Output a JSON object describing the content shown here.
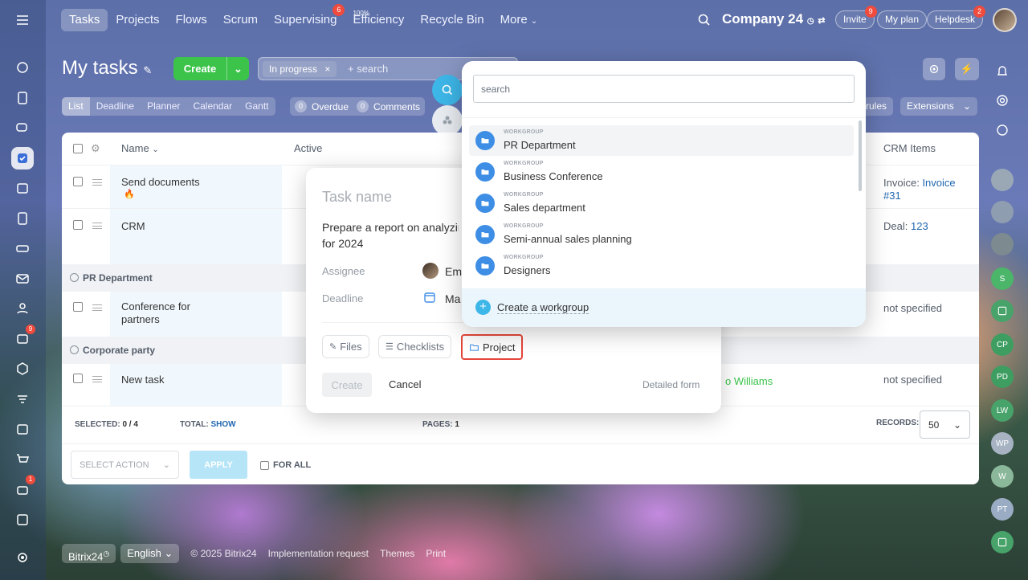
{
  "nav": {
    "items": [
      {
        "label": "Tasks",
        "active": true
      },
      {
        "label": "Projects"
      },
      {
        "label": "Flows"
      },
      {
        "label": "Scrum"
      },
      {
        "label": "Supervising",
        "badge": "6"
      },
      {
        "label": "Efficiency",
        "sup": "100%"
      },
      {
        "label": "Recycle Bin"
      },
      {
        "label": "More"
      }
    ],
    "company": "Company 24",
    "invite": "Invite",
    "invite_badge": "9",
    "my_plan": "My plan",
    "helpdesk": "Helpdesk",
    "helpdesk_badge": "2"
  },
  "left_badges": {
    "feed": "9",
    "shop": "1"
  },
  "header": {
    "title": "My tasks",
    "create": "Create",
    "filter_chip": "In progress",
    "filter_placeholder": "+ search"
  },
  "view_tabs": [
    "List",
    "Deadline",
    "Planner",
    "Calendar",
    "Gantt"
  ],
  "counters": [
    {
      "count": "0",
      "label": "Overdue"
    },
    {
      "count": "0",
      "label": "Comments"
    }
  ],
  "right_controls": {
    "rules": "rules",
    "extensions": "Extensions"
  },
  "table": {
    "col_name": "Name",
    "col_active": "Active",
    "col_crm": "CRM Items",
    "rows": [
      {
        "name": "Send documents",
        "crm_label": "Invoice:",
        "crm_link": "Invoice #31"
      },
      {
        "name": "CRM",
        "crm_label": "Deal:",
        "crm_link": "123"
      }
    ],
    "group1": "PR Department",
    "row3": {
      "name": "Conference for partners",
      "crm": "not specified"
    },
    "group2": "Corporate party",
    "row4": {
      "name": "New task",
      "responsible": "o Williams",
      "crm": "not specified"
    },
    "selected_label": "SELECTED:",
    "selected_value": "0 / 4",
    "total_label": "TOTAL:",
    "total_value": "SHOW",
    "pages_label": "PAGES:",
    "pages_value": "1",
    "records_label": "RECORDS:",
    "records_value": "50",
    "select_action": "SELECT ACTION",
    "apply": "APPLY",
    "for_all": "FOR ALL"
  },
  "quick_form": {
    "title_placeholder": "Task name",
    "description": "Prepare a report on analyzin",
    "description_line2": "for 2024",
    "assignee_label": "Assignee",
    "assignee_value": "Em",
    "deadline_label": "Deadline",
    "deadline_value": "Ma",
    "files": "Files",
    "checklists": "Checklists",
    "project": "Project",
    "create": "Create",
    "cancel": "Cancel",
    "detailed": "Detailed form"
  },
  "dropdown": {
    "search_placeholder": "search",
    "items": [
      {
        "kind": "WORKGROUP",
        "name": "PR Department"
      },
      {
        "kind": "WORKGROUP",
        "name": "Business Conference"
      },
      {
        "kind": "WORKGROUP",
        "name": "Sales department"
      },
      {
        "kind": "WORKGROUP",
        "name": "Semi-annual sales planning"
      },
      {
        "kind": "WORKGROUP",
        "name": "Designers"
      }
    ],
    "create_label": "Create a workgroup"
  },
  "right_bar": [
    "S",
    "CP",
    "PD",
    "LW",
    "WP",
    "W",
    "PT"
  ],
  "footer": {
    "brand": "Bitrix24",
    "language": "English",
    "copyright": "© 2025 Bitrix24",
    "impl": "Implementation request",
    "themes": "Themes",
    "print": "Print"
  },
  "colors": {
    "accent": "#3bc34a",
    "highlight": "#e5463a",
    "primary": "#3e8ee6"
  }
}
